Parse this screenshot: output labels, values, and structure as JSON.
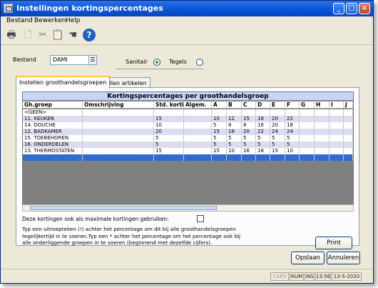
{
  "window": {
    "title": "Instellingen kortingspercentages"
  },
  "menu": [
    "Bestand",
    "Bewerken",
    "Help"
  ],
  "toolbar": {
    "help_label": "?"
  },
  "bestand": {
    "label": "Bestand",
    "value": "DAMI"
  },
  "radios": [
    {
      "label": "Sanitair",
      "checked": true
    },
    {
      "label": "Tegels",
      "checked": false
    }
  ],
  "tabs": [
    "Instellen groothandelsgroepen",
    "Instellen artikelen"
  ],
  "grid": {
    "title": "Kortingspercentages per groothandelsgroep",
    "columns": [
      "Gh.groep",
      "Omschrijving",
      "Std. korti",
      "Algem.",
      "A",
      "B",
      "C",
      "D",
      "E",
      "F",
      "G",
      "H",
      "I",
      "J"
    ],
    "rows": [
      [
        "<GEEN>",
        "",
        "",
        "",
        "",
        "",
        "",
        "",
        "",
        "",
        "",
        "",
        "",
        ""
      ],
      [
        "11. KEUKEN",
        "",
        "15",
        "",
        "10",
        "12",
        "15",
        "18",
        "20",
        "22",
        "",
        "",
        "",
        ""
      ],
      [
        "14. DOUCHE",
        "",
        "10",
        "",
        "5",
        "8",
        "8",
        "16",
        "20",
        "18",
        "",
        "",
        "",
        ""
      ],
      [
        "12. BADKAMER",
        "",
        "20",
        "",
        "15",
        "18",
        "20",
        "22",
        "24",
        "24",
        "",
        "",
        "",
        ""
      ],
      [
        "15. TOEBEHOREN",
        "",
        "5",
        "",
        "5",
        "5",
        "5",
        "5",
        "5",
        "5",
        "",
        "",
        "",
        ""
      ],
      [
        "16. ONDERDELEN",
        "",
        "5",
        "",
        "5",
        "5",
        "5",
        "5",
        "5",
        "5",
        "",
        "",
        "",
        ""
      ],
      [
        "13. THERMOSTATEN",
        "",
        "15",
        "",
        "15",
        "10",
        "16",
        "18",
        "15",
        "10",
        "",
        "",
        "",
        ""
      ]
    ]
  },
  "maxdiscount": {
    "label": "Deze kortingen ook als maximale kortingen gebruiken:",
    "checked": false
  },
  "help_text": {
    "line1": "Typ een uitroepteken (!) achter het percentage om dit bij alle groothandelsgroepen",
    "line2": "tegelijkertijd in te voeren.Typ een * achter het percentage om het percentage ook bij",
    "line3": "alle onderliggende groepen in te voeren (beginnend met dezelfde cijfers)."
  },
  "buttons": {
    "print": "Print",
    "save": "Opslaan",
    "cancel": "Annuleren"
  },
  "status": {
    "caps": "CAPS",
    "num": "NUM",
    "ins": "INS",
    "time": "13:56",
    "date": "13-5-2020"
  }
}
